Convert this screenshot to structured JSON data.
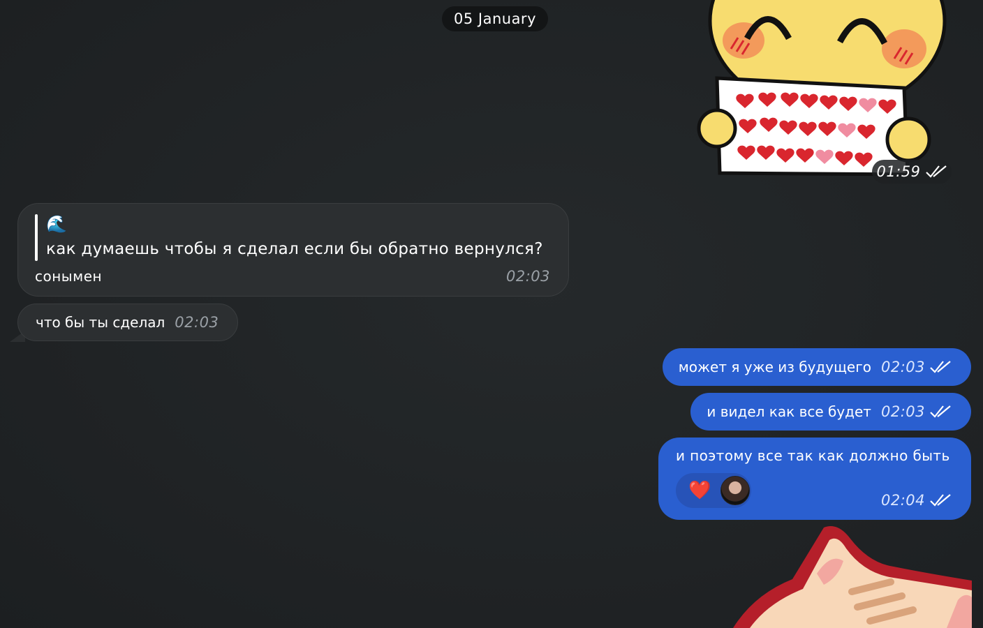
{
  "date_separator": "05 January",
  "sticker_top": {
    "time": "01:59",
    "read": true
  },
  "incoming": {
    "quote_message": {
      "quote_emoji": "🌊",
      "quote_text": "как думаешь чтобы я сделал если бы обратно вернулся?",
      "caption": "сонымен",
      "time": "02:03"
    },
    "simple_message": {
      "text": "что бы ты сделал",
      "time": "02:03"
    }
  },
  "outgoing": [
    {
      "text": "может я уже из будущего",
      "time": "02:03",
      "read": true
    },
    {
      "text": "и видел как все будет",
      "time": "02:03",
      "read": true
    },
    {
      "text": "и поэтому все так как должно быть",
      "time": "02:04",
      "read": true,
      "reaction": "❤️"
    }
  ],
  "colors": {
    "background": "#1f2224",
    "incoming_bubble": "#2c2f31",
    "outgoing_bubble": "#2a5fd0",
    "sticker_yellow": "#f7dc6f",
    "heart_red": "#d9262e"
  },
  "icons": {
    "read_ticks": "double-check-icon",
    "sticker_top": "smiley-holding-hearts-sticker",
    "sticker_bottom": "cat-sticker",
    "reaction": "heart-icon"
  }
}
